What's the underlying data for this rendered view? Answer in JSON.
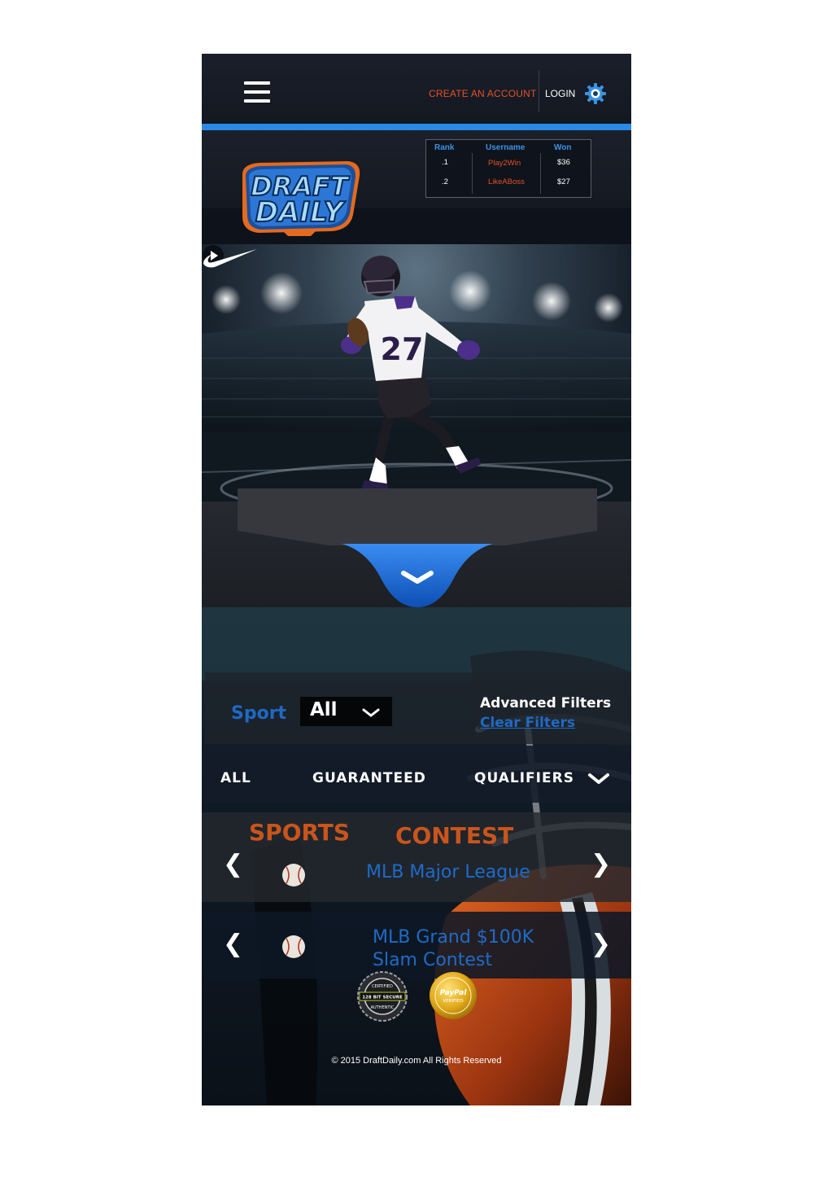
{
  "header": {
    "create_account": "CREATE AN ACCOUNT",
    "login": "LOGIN",
    "menu_icon": "hamburger-icon",
    "settings_icon": "gear-icon"
  },
  "brand": {
    "logo_line1": "DRAFT",
    "logo_line2": "DAILY"
  },
  "leaderboard": {
    "columns": [
      "Rank",
      "Username",
      "Won"
    ],
    "rows": [
      {
        "rank": ".1",
        "username": "Play2Win",
        "won": "$36"
      },
      {
        "rank": ".2",
        "username": "LikeABoss",
        "won": "$27"
      }
    ]
  },
  "hero": {
    "jersey_number": "27",
    "play_icon": "play-icon",
    "expand_icon": "chevron-down-icon"
  },
  "filters": {
    "sport_label": "Sport",
    "sport_value": "All",
    "advanced": "Advanced Filters",
    "clear": "Clear Filters"
  },
  "tabs": [
    "ALL",
    "GUARANTEED",
    "QUALIFIERS"
  ],
  "contest_header": {
    "sports": "SPORTS",
    "contest": "CONTEST"
  },
  "contests": [
    {
      "title_line1": "MLB Major League",
      "title_line2": "",
      "sport_icon": "baseball-icon"
    },
    {
      "title_line1": "MLB Grand $100K",
      "title_line2": "Slam Contest",
      "sport_icon": "baseball-icon"
    }
  ],
  "badges": {
    "secure_line1": "CERTIFIED",
    "secure_line2": "128 BIT SECURE",
    "secure_line3": "AUTHENTIC",
    "paypal_line1": "PayPal",
    "paypal_line2": "VERIFIED"
  },
  "footer": {
    "copyright": "© 2015 DraftDaily.com All Rights Reserved"
  },
  "colors": {
    "accent_blue": "#2a8ae8",
    "accent_orange": "#e2512a",
    "contest_blue": "#1e6bc9",
    "header_orange": "#c9551c"
  }
}
